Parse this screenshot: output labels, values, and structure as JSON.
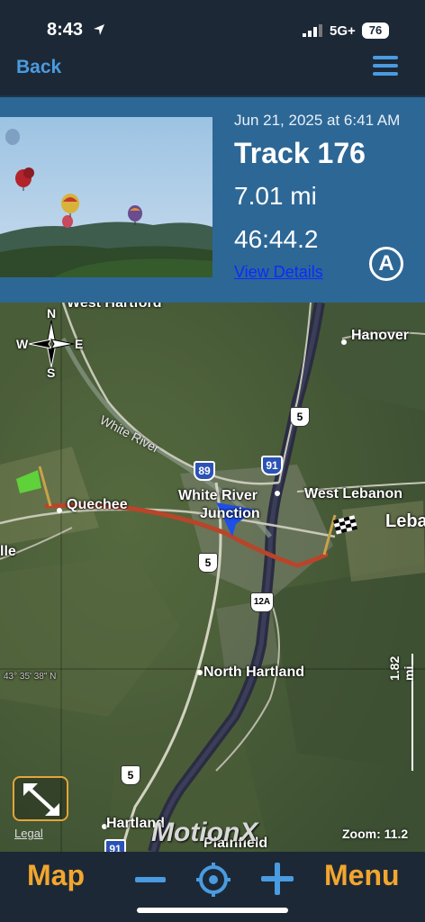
{
  "status_bar": {
    "time": "8:43",
    "network": "5G+",
    "battery": "76"
  },
  "nav": {
    "back_label": "Back",
    "menu_icon": "hamburger-icon"
  },
  "track": {
    "date": "Jun 21, 2025 at 6:41 AM",
    "name": "Track 176",
    "distance": "7.01 mi",
    "duration": "46:44.2",
    "details_link": "View Details",
    "badge": "A"
  },
  "map": {
    "compass": {
      "n": "N",
      "s": "S",
      "e": "E",
      "w": "W"
    },
    "places": {
      "west_hartford": "West Hartford",
      "hanover": "Hanover",
      "white_river": "White River",
      "white_river_junction_line1": "White River",
      "white_river_junction_line2": "Junction",
      "west_lebanon": "West Lebanon",
      "lebanon": "Leba",
      "quechee": "Quechee",
      "ville": "lle",
      "north_hartland": "North Hartland",
      "hartland": "Hartland",
      "plainfield": "Plainfield"
    },
    "routes": {
      "us5_a": "5",
      "i89": "89",
      "i91_a": "91",
      "us5_b": "5",
      "nh12a": "12A",
      "us5_c": "5",
      "i91_b": "91"
    },
    "coordinate_text": "43° 35' 38\" N",
    "scale": "1.82 mi",
    "zoom": "Zoom: 11.2",
    "brand": "MotionX",
    "legal": "Legal",
    "colors": {
      "track_line": "#b8452a",
      "heading_marker": "#1f4fe8",
      "start_flag": "#5fd13a"
    }
  },
  "toolbar": {
    "map_label": "Map",
    "menu_label": "Menu",
    "zoom_out_icon": "minus-icon",
    "locate_icon": "crosshair-icon",
    "zoom_in_icon": "plus-icon",
    "accent": "#f2a62e",
    "icon_color": "#4a9be0"
  }
}
